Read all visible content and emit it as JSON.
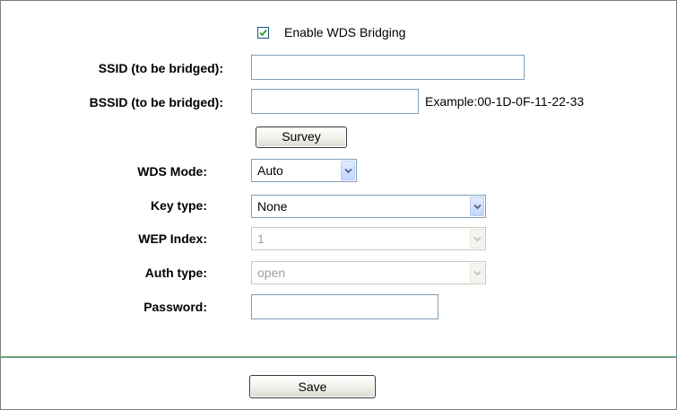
{
  "wds": {
    "enable_label": "Enable WDS Bridging",
    "enabled": true
  },
  "ssid": {
    "label": "SSID (to be bridged):",
    "value": ""
  },
  "bssid": {
    "label": "BSSID (to be bridged):",
    "value": "",
    "example": "Example:00-1D-0F-11-22-33"
  },
  "survey_label": "Survey",
  "wds_mode": {
    "label": "WDS Mode:",
    "selected": "Auto"
  },
  "key_type": {
    "label": "Key type:",
    "selected": "None"
  },
  "wep_index": {
    "label": "WEP Index:",
    "selected": "1",
    "disabled": true
  },
  "auth_type": {
    "label": "Auth type:",
    "selected": "open",
    "disabled": true
  },
  "password": {
    "label": "Password:",
    "value": ""
  },
  "save_label": "Save",
  "colors": {
    "divider": "#67a37c",
    "input_border": "#7f9db9",
    "disabled_text": "#a0a0a0"
  },
  "icons": {
    "checkbox": "checkmark-icon",
    "dropdown": "chevron-down-icon"
  }
}
